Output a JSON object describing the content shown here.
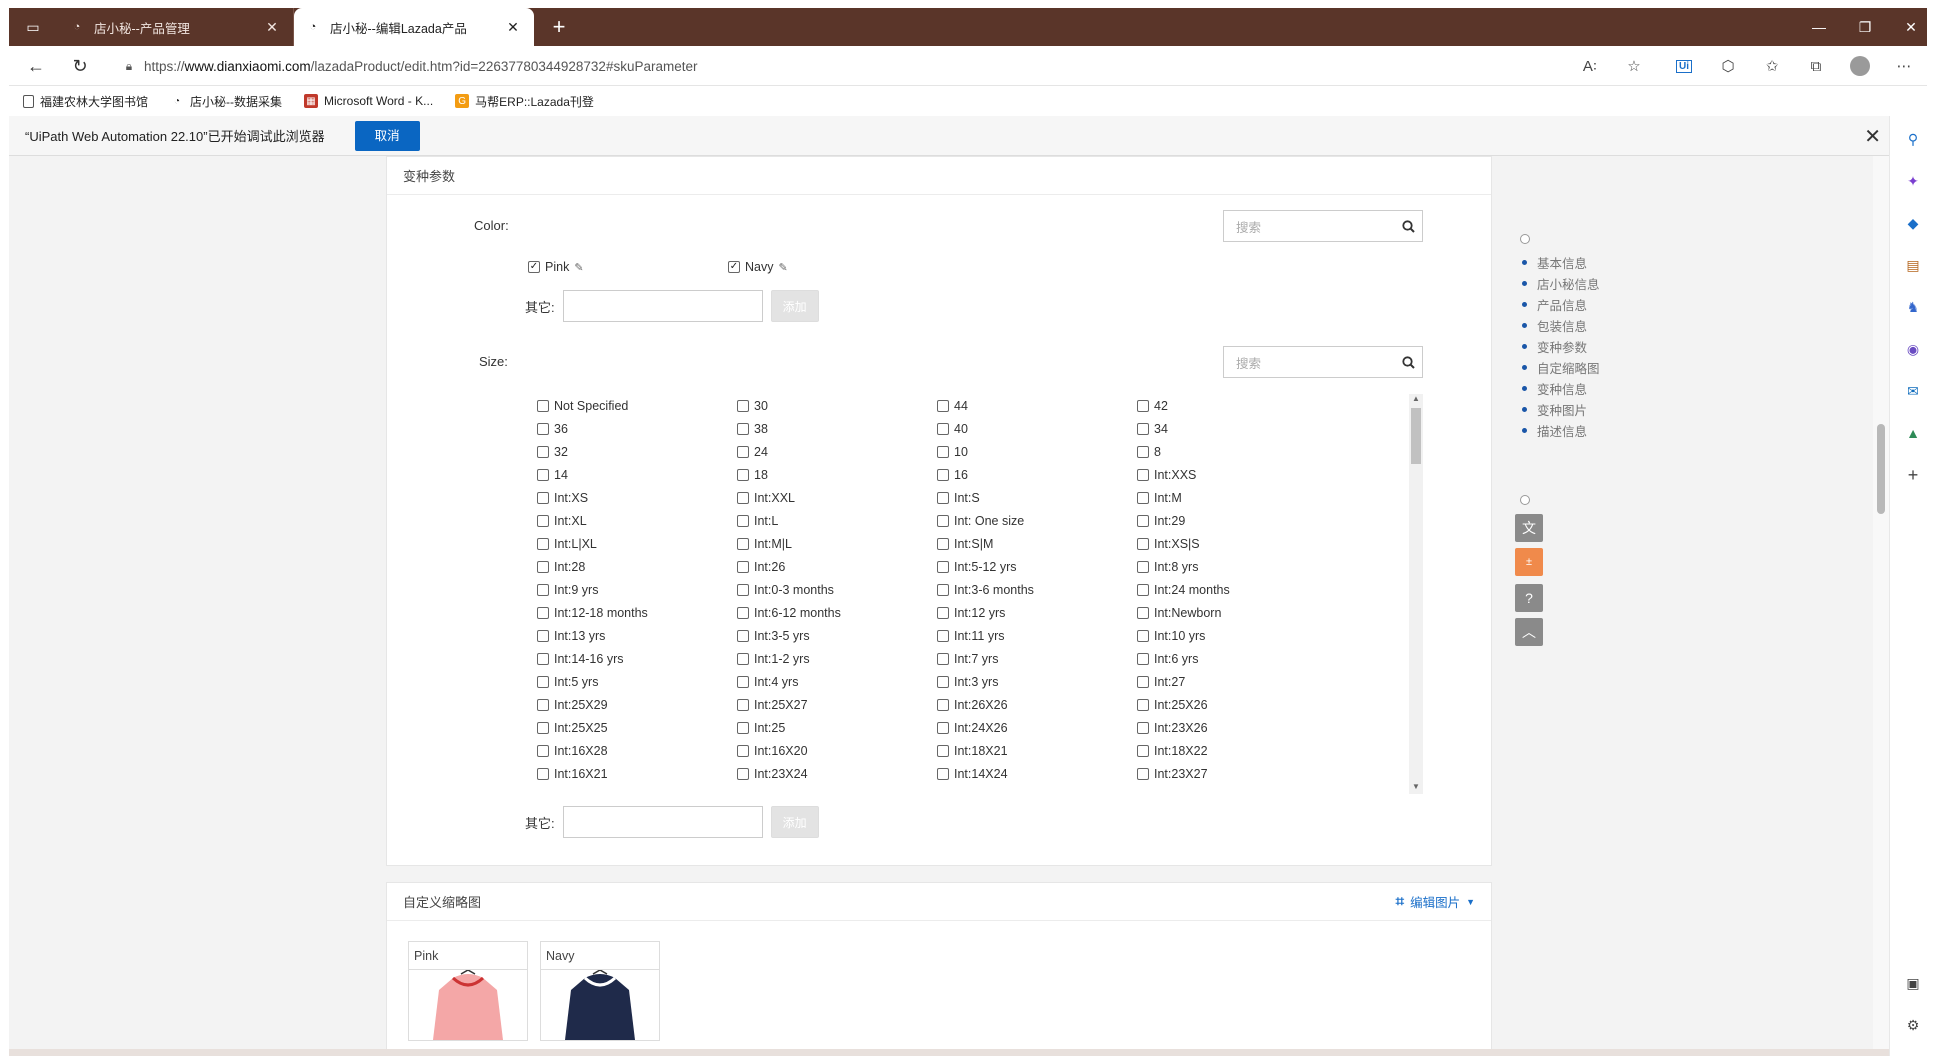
{
  "browser": {
    "tabs": [
      {
        "label": "店小秘--产品管理",
        "active": false
      },
      {
        "label": "店小秘--编辑Lazada产品",
        "active": true
      }
    ],
    "url_prefix": "https://",
    "url_host": "www.dianxiaomi.com",
    "url_path": "/lazadaProduct/edit.htm?id=22637780344928732#skuParameter",
    "bookmarks": [
      "福建农林大学图书馆",
      "店小秘--数据采集",
      "Microsoft Word - K...",
      "马帮ERP::Lazada刊登"
    ]
  },
  "infobar": {
    "message": "“UiPath Web Automation 22.10”已开始调试此浏览器",
    "cancel_label": "取消"
  },
  "variant_section": {
    "title": "变种参数",
    "color_label": "Color:",
    "size_label": "Size:",
    "search_placeholder": "搜索",
    "other_label": "其它:",
    "add_label": "添加",
    "colors": [
      {
        "label": "Pink",
        "checked": true
      },
      {
        "label": "Navy",
        "checked": true
      }
    ],
    "sizes": [
      "Not Specified",
      "30",
      "44",
      "42",
      "36",
      "38",
      "40",
      "34",
      "32",
      "24",
      "10",
      "8",
      "14",
      "18",
      "16",
      "Int:XXS",
      "Int:XS",
      "Int:XXL",
      "Int:S",
      "Int:M",
      "Int:XL",
      "Int:L",
      "Int: One size",
      "Int:29",
      "Int:L|XL",
      "Int:M|L",
      "Int:S|M",
      "Int:XS|S",
      "Int:28",
      "Int:26",
      "Int:5-12 yrs",
      "Int:8 yrs",
      "Int:9 yrs",
      "Int:0-3 months",
      "Int:3-6 months",
      "Int:24 months",
      "Int:12-18 months",
      "Int:6-12 months",
      "Int:12 yrs",
      "Int:Newborn",
      "Int:13 yrs",
      "Int:3-5 yrs",
      "Int:11 yrs",
      "Int:10 yrs",
      "Int:14-16 yrs",
      "Int:1-2 yrs",
      "Int:7 yrs",
      "Int:6 yrs",
      "Int:5 yrs",
      "Int:4 yrs",
      "Int:3 yrs",
      "Int:27",
      "Int:25X29",
      "Int:25X27",
      "Int:26X26",
      "Int:25X26",
      "Int:25X25",
      "Int:25",
      "Int:24X26",
      "Int:23X26",
      "Int:16X28",
      "Int:16X20",
      "Int:18X21",
      "Int:18X22",
      "Int:16X21",
      "Int:23X24",
      "Int:14X24",
      "Int:23X27"
    ]
  },
  "thumbnail_section": {
    "title": "自定义缩略图",
    "edit_label": "编辑图片",
    "items": [
      "Pink",
      "Navy"
    ]
  },
  "anchor_nav": [
    "基本信息",
    "店小秘信息",
    "产品信息",
    "包装信息",
    "变种参数",
    "自定缩略图",
    "变种信息",
    "变种图片",
    "描述信息"
  ],
  "colors": {
    "titlebar": "#5a3529",
    "primary_button": "#0a66c2",
    "anchor_dot": "#1a56a8",
    "edit_link": "#1a6fc9"
  }
}
